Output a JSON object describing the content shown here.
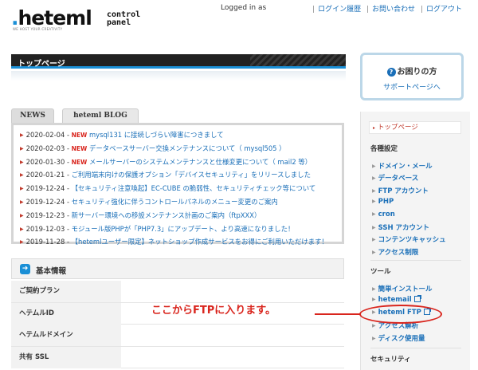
{
  "header": {
    "logo_text": "heteml",
    "logo_sub_line1": "control",
    "logo_sub_line2": "panel",
    "logo_tagline": "WE HOST YOUR CREATIVITY",
    "logged_in": "Logged in as",
    "nav": [
      "ログイン履歴",
      "お問い合わせ",
      "ログアウト"
    ]
  },
  "page_title": "トップページ",
  "help": {
    "title": "お困りの方",
    "link": "サポートページへ"
  },
  "tabs": [
    "NEWS",
    "heteml BLOG"
  ],
  "news": [
    {
      "date": "2020-02-04",
      "new": "NEW",
      "text": "mysql131 に接続しづらい障害につきまして"
    },
    {
      "date": "2020-02-03",
      "new": "NEW",
      "text": "データベースサーバー交換メンテナンスについて（ mysql505 ）"
    },
    {
      "date": "2020-01-30",
      "new": "NEW",
      "text": "メールサーバーのシステムメンテナンスと仕様変更について（ mail2 等）"
    },
    {
      "date": "2020-01-21",
      "new": "",
      "text": "ご利用端末向けの保護オプション「デバイスセキュリティ」をリリースしました"
    },
    {
      "date": "2019-12-24",
      "new": "",
      "text": "【セキュリティ注意喚起】EC-CUBE の脆弱性、セキュリティチェック等について"
    },
    {
      "date": "2019-12-24",
      "new": "",
      "text": "セキュリティ強化に伴うコントロールパネルのメニュー変更のご案内"
    },
    {
      "date": "2019-12-23",
      "new": "",
      "text": "新サーバー環境への移設メンテナンス計画のご案内（ftpXXX）"
    },
    {
      "date": "2019-12-03",
      "new": "",
      "text": "モジュール版PHPが「PHP7.3」にアップデート、より高速になりました！"
    },
    {
      "date": "2019-11-28",
      "new": "",
      "text": "【hetemlユーザー限定】ネットショップ作成サービスをお得にご利用いただけます！"
    }
  ],
  "basic": {
    "title": "基本情報",
    "rows": [
      "ご契約プラン",
      "ヘテムルID",
      "ヘテムルドメイン",
      "共有 SSL"
    ]
  },
  "sidebar": {
    "top_link": "トップページ",
    "section1": "各種設定",
    "items1": [
      "ドメイン・メール",
      "データベース",
      "FTP アカウント",
      "PHP",
      "cron",
      "SSH アカウント",
      "コンテンツキャッシュ",
      "アクセス制限"
    ],
    "section2": "ツール",
    "items2": [
      "簡単インストール",
      "hetemail",
      "heteml FTP",
      "アクセス解析",
      "ディスク使用量"
    ],
    "section3": "セキュリティ"
  },
  "annotation": "ここからFTPに入ります。",
  "colors": {
    "accent": "#1a8fd6",
    "link": "#1a6fb8",
    "new_badge": "#d9251d",
    "annotation": "#d9251d"
  }
}
